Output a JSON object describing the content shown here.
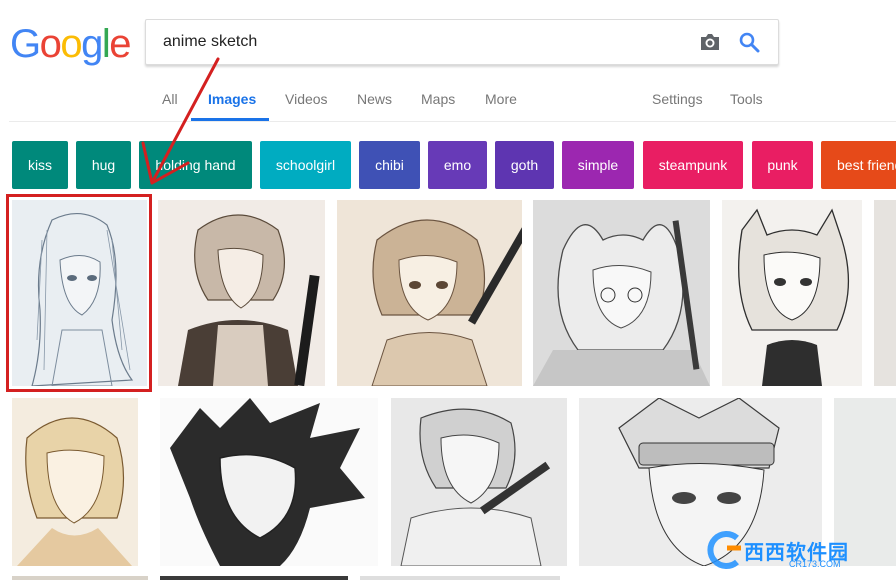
{
  "logo": {
    "letters": [
      "G",
      "o",
      "o",
      "g",
      "l",
      "e"
    ]
  },
  "search": {
    "value": "anime sketch"
  },
  "tabs": {
    "items": [
      "All",
      "Images",
      "Videos",
      "News",
      "Maps",
      "More"
    ],
    "right": [
      "Settings",
      "Tools"
    ],
    "active": "Images"
  },
  "chips": [
    {
      "label": "kiss",
      "color": "#00897b"
    },
    {
      "label": "hug",
      "color": "#00897b"
    },
    {
      "label": "holding hand",
      "color": "#00897b"
    },
    {
      "label": "schoolgirl",
      "color": "#00acc1"
    },
    {
      "label": "chibi",
      "color": "#3f51b5"
    },
    {
      "label": "emo",
      "color": "#673ab7"
    },
    {
      "label": "goth",
      "color": "#5e35b1"
    },
    {
      "label": "simple",
      "color": "#9c27b0"
    },
    {
      "label": "steampunk",
      "color": "#e91e63"
    },
    {
      "label": "punk",
      "color": "#e91e63"
    },
    {
      "label": "best friends",
      "color": "#e64a19"
    }
  ],
  "watermark": {
    "brand": "西西软件园",
    "url": "CR173.COM"
  },
  "colors": {
    "accent": "#1a73e8",
    "highlight": "#d42020"
  }
}
